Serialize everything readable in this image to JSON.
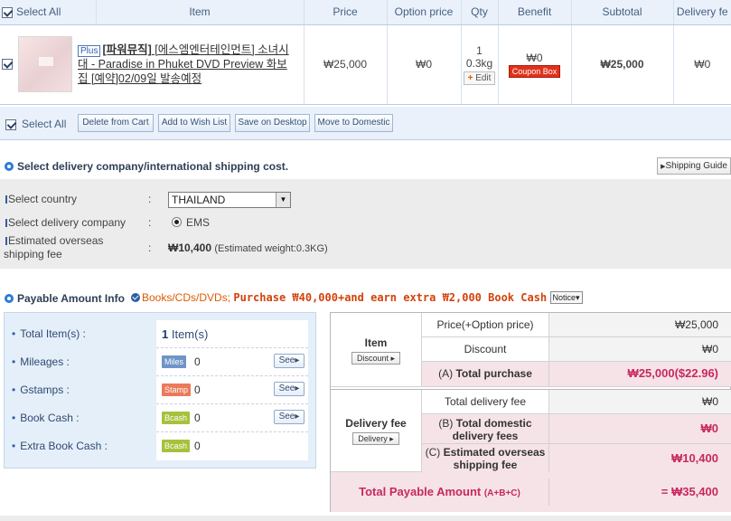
{
  "cart": {
    "headers": {
      "select_all": "Select All",
      "item": "Item",
      "price": "Price",
      "option_price": "Option price",
      "qty": "Qty",
      "benefit": "Benefit",
      "subtotal": "Subtotal",
      "delivery_fee": "Delivery fe"
    },
    "row": {
      "plus_badge": "Plus",
      "brand": "[파워뮤직]",
      "title": " [에스엠엔터테인먼트] 소녀시대 - Paradise in Phuket DVD Preview 화보집 [예약]02/09일 발송예정",
      "price": "₩25,000",
      "option_price": "₩0",
      "qty": "1",
      "weight": "0.3kg",
      "edit_label": "Edit",
      "benefit": "₩0",
      "coupon_label": "Coupon Box",
      "subtotal": "₩25,000",
      "delivery_fee": "₩0"
    }
  },
  "actions": {
    "select_all": "Select All",
    "delete": "Delete from Cart",
    "wishlist": "Add to Wish List",
    "save_desktop": "Save on Desktop",
    "move_domestic": "Move to Domestic"
  },
  "shipping": {
    "section_title": "Select delivery company/international shipping cost.",
    "guide_button": "Shipping Guide",
    "country_label": "Select country",
    "country_value": "THAILAND",
    "company_label": "Select delivery company",
    "company_value": "EMS",
    "estimate_label_1": "Estimated overseas",
    "estimate_label_2": "shipping fee",
    "estimate_value": "₩10,400",
    "estimate_note": "(Estimated weight:0.3KG)",
    "colon": ":"
  },
  "payable": {
    "section_title": "Payable Amount Info",
    "promo_category": "Books/CDs/DVDs;",
    "promo_text": "Purchase ₩40,000+and earn extra ₩2,000 Book Cash",
    "notice_button": "Notice",
    "left": {
      "total_items_label": "Total Item(s) :",
      "total_items_count": "1",
      "total_items_unit": " Item(s)",
      "mileages_label": "Mileages :",
      "mileages_tag": "Miles",
      "mileages_value": "0",
      "gstamps_label": "Gstamps :",
      "gstamps_tag": "Stamp",
      "gstamps_value": "0",
      "bookcash_label": "Book Cash :",
      "bookcash_tag": "Bcash",
      "bookcash_value": "0",
      "extra_label": "Extra Book Cash :",
      "extra_tag": "Bcash",
      "extra_value": "0",
      "see_label": "See"
    },
    "right": {
      "item_title": "Item",
      "discount_button": "Discount",
      "price_label": "Price(+Option price)",
      "price_value": "₩25,000",
      "discount_label": "Discount",
      "discount_value": "₩0",
      "total_purchase_prefix": "(A) ",
      "total_purchase_label": "Total purchase",
      "total_purchase_value": "₩25,000($22.96)",
      "delivery_title": "Delivery fee",
      "delivery_button": "Delivery",
      "total_delivery_label": "Total delivery fee",
      "total_delivery_value": "₩0",
      "domestic_prefix": "(B) ",
      "domestic_label": "Total domestic delivery fees",
      "domestic_value": "₩0",
      "overseas_prefix": "(C) ",
      "overseas_label": "Estimated overseas shipping fee",
      "overseas_value": "₩10,400",
      "total_label": "Total Payable Amount",
      "total_suffix": "(A+B+C)",
      "total_value": "=  ₩35,400"
    }
  }
}
